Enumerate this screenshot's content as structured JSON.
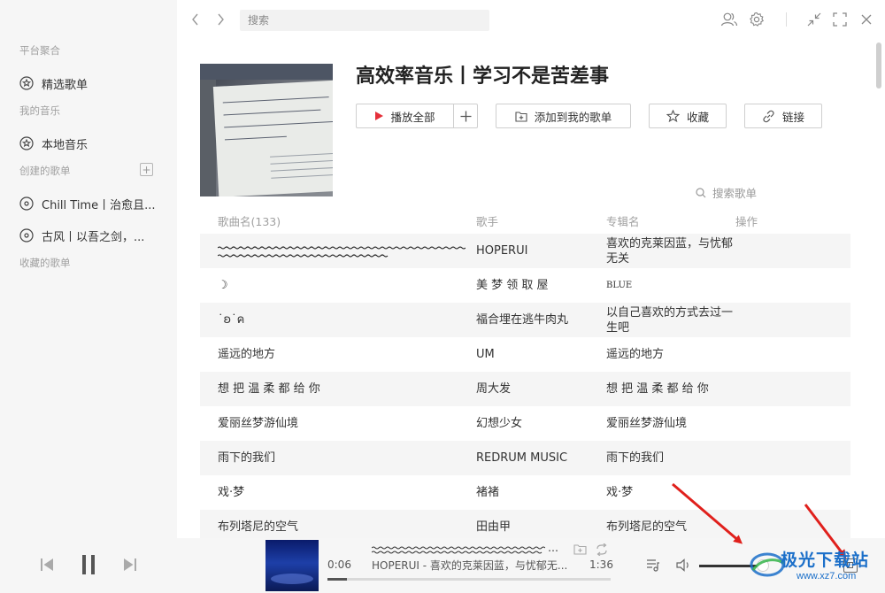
{
  "sidebar": {
    "section_platform": "平台聚合",
    "featured_label": "精选歌单",
    "section_my_music": "我的音乐",
    "local_label": "本地音乐",
    "section_created": "创建的歌单",
    "add_playlist": "+",
    "created_playlists": [
      {
        "label": "Chill Time丨治愈且..."
      },
      {
        "label": "古风丨以吾之剑，..."
      }
    ],
    "section_collected": "收藏的歌单"
  },
  "topbar": {
    "search_placeholder": "搜索"
  },
  "playlist": {
    "title": "高效率音乐丨学习不是苦差事",
    "play_all_label": "播放全部",
    "add_to_label": "添加到我的歌单",
    "collect_label": "收藏",
    "link_label": "链接",
    "search_songs_placeholder": "搜索歌单"
  },
  "table": {
    "headers": {
      "title": "歌曲名(133)",
      "artist": "歌手",
      "album": "专辑名",
      "actions": "操作"
    },
    "rows": [
      {
        "title": "",
        "artist": "HOPERUI",
        "album": "喜欢的克莱因蓝，与忧郁无关"
      },
      {
        "title": "☽",
        "artist": "美 梦 领 取 屋",
        "album": "BLUE"
      },
      {
        "title": "˙ʚ˙ค",
        "artist": "福合埋在逃牛肉丸",
        "album": "以自己喜欢的方式去过一生吧"
      },
      {
        "title": "遥远的地方",
        "artist": "UM",
        "album": "遥远的地方"
      },
      {
        "title": "想 把 温 柔 都 给 你",
        "artist": "周大发",
        "album": "想 把 温 柔 都 给 你"
      },
      {
        "title": "爱丽丝梦游仙境",
        "artist": "幻想少女",
        "album": "爱丽丝梦游仙境"
      },
      {
        "title": "雨下的我们",
        "artist": "REDRUM MUSIC",
        "album": "雨下的我们"
      },
      {
        "title": "戏·梦",
        "artist": "褚褚",
        "album": "戏·梦"
      },
      {
        "title": "布列塔尼的空气",
        "artist": "田由甲",
        "album": "布列塔尼的空气"
      }
    ]
  },
  "player": {
    "current_time": "0:06",
    "total_time": "1:36",
    "track_text": "HOPERUI - 喜欢的克莱因蓝，与忧郁无...",
    "progress_fraction": 0.07
  },
  "watermark": {
    "text": "极光下载站",
    "url": "www.xz7.com"
  },
  "colors": {
    "accent_red": "#e5303a",
    "arrow_red": "#e0201c",
    "watermark_blue": "#1b6fc9"
  }
}
